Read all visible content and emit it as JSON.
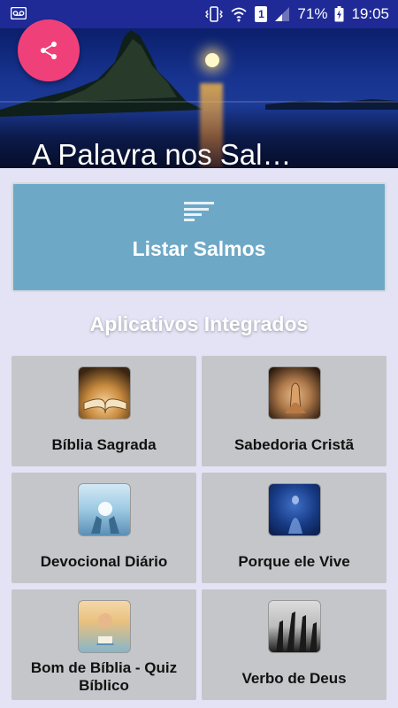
{
  "status_bar": {
    "battery_percent": "71%",
    "time": "19:05",
    "sim_slot": "1",
    "icons": [
      "voicemail-icon",
      "vibrate-icon",
      "wifi-icon",
      "signal-icon",
      "battery-charging-icon"
    ]
  },
  "header": {
    "title": "A Palavra nos Sal…",
    "share_icon": "share-icon"
  },
  "list_button": {
    "label": "Listar Salmos",
    "icon": "sort-list-icon"
  },
  "section": {
    "title": "Aplicativos Integrados"
  },
  "apps": [
    {
      "label": "Bíblia Sagrada",
      "thumb": "open-bible-image"
    },
    {
      "label": "Sabedoria Cristã",
      "thumb": "praying-hands-image"
    },
    {
      "label": "Devocional Diário",
      "thumb": "hands-light-image"
    },
    {
      "label": "Porque ele Vive",
      "thumb": "jesus-figure-image"
    },
    {
      "label": "Bom de Bíblia - Quiz Bíblico",
      "thumb": "child-reading-image"
    },
    {
      "label": "Verbo de Deus",
      "thumb": "worship-hands-image"
    }
  ],
  "colors": {
    "status_bar": "#1f2a96",
    "fab": "#f0407a",
    "list_button": "#6ea8c7",
    "background": "#e3e3f5",
    "card": "#c4c6c9"
  }
}
